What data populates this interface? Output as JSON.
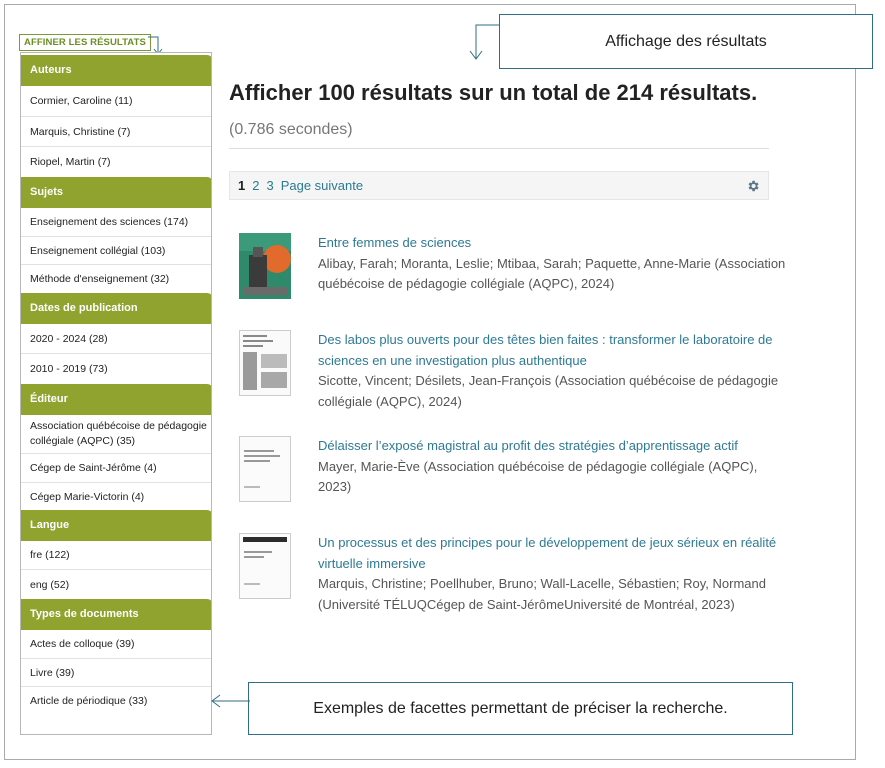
{
  "refine_label": "AFFINER LES RÉSULTATS",
  "facets": [
    {
      "title": "Auteurs",
      "items": [
        "Cormier, Caroline (11)",
        "Marquis, Christine (7)",
        "Riopel, Martin (7)"
      ]
    },
    {
      "title": "Sujets",
      "items": [
        "Enseignement des sciences (174)",
        "Enseignement collégial (103)",
        "Méthode d'enseignement (32)"
      ]
    },
    {
      "title": "Dates de publication",
      "items": [
        "2020 - 2024 (28)",
        "2010 - 2019 (73)"
      ]
    },
    {
      "title": "Éditeur",
      "items": [
        "Association québécoise de pédagogie collégiale (AQPC) (35)",
        "Cégep de Saint-Jérôme (4)",
        "Cégep Marie-Victorin (4)"
      ]
    },
    {
      "title": "Langue",
      "items": [
        "fre (122)",
        "eng (52)"
      ]
    },
    {
      "title": "Types de documents",
      "items": [
        "Actes de colloque (39)",
        "Livre (39)",
        "Article de périodique (33)"
      ]
    }
  ],
  "callouts": {
    "results": "Affichage des résultats",
    "facets": "Exemples de facettes permettant de préciser la recherche."
  },
  "summary": {
    "text": "Afficher 100 résultats sur un total de 214 résultats.",
    "seconds": "(0.786 secondes)"
  },
  "pager": {
    "current": "1",
    "pages": [
      "2",
      "3"
    ],
    "next": "Page suivante",
    "settings_icon": "gear-icon"
  },
  "results": [
    {
      "title": "Entre femmes de sciences",
      "meta": "Alibay, Farah; Moranta, Leslie; Mtibaa, Sarah; Paquette, Anne-Marie (Association québécoise de pédagogie collégiale (AQPC), 2024)"
    },
    {
      "title": "Des labos plus ouverts pour des têtes bien faites : transformer le laboratoire de sciences en une investigation plus authentique",
      "meta": "Sicotte, Vincent; Désilets, Jean-François (Association québécoise de pédagogie collégiale (AQPC), 2024)"
    },
    {
      "title": "Délaisser l’exposé magistral au profit des stratégies d’apprentissage actif",
      "meta": "Mayer, Marie-Ève (Association québécoise de pédagogie collégiale (AQPC), 2023)"
    },
    {
      "title": "Un processus et des principes pour le développement de jeux sérieux en réalité virtuelle immersive",
      "meta": "Marquis, Christine; Poellhuber, Bruno; Wall-Lacelle, Sébastien; Roy, Normand (Université TÉLUQCégep de Saint-JérômeUniversité de Montréal, 2023)"
    }
  ],
  "colors": {
    "facet_header": "#8fa32e",
    "link": "#2d7a93",
    "callout_border": "#2e6f86"
  }
}
